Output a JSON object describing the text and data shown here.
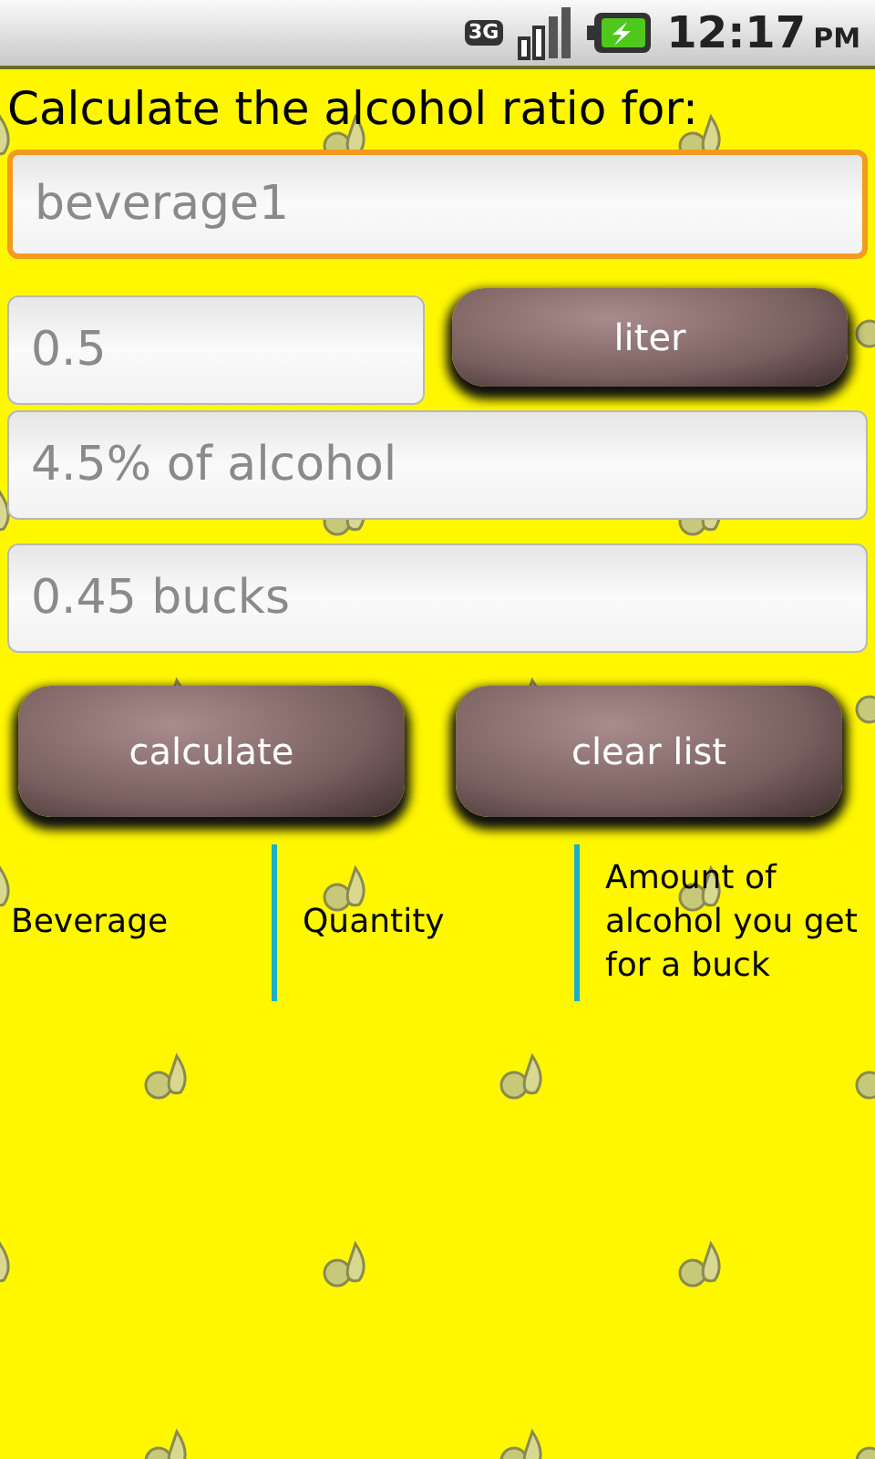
{
  "status_bar": {
    "network": "3G",
    "time": "12:17",
    "ampm": "PM"
  },
  "title": "Calculate the alcohol ratio for:",
  "beverage_field": {
    "placeholder": "beverage1",
    "focused": true
  },
  "quantity_field": {
    "placeholder": "0.5"
  },
  "unit_button": "liter",
  "alcohol_field": {
    "placeholder": "4.5% of alcohol"
  },
  "price_field": {
    "placeholder": "0.45 bucks"
  },
  "buttons": [
    "calculate",
    "clear list"
  ],
  "table": {
    "columns": [
      "Beverage",
      "Quantity",
      "Amount of alcohol you get for a buck"
    ]
  }
}
